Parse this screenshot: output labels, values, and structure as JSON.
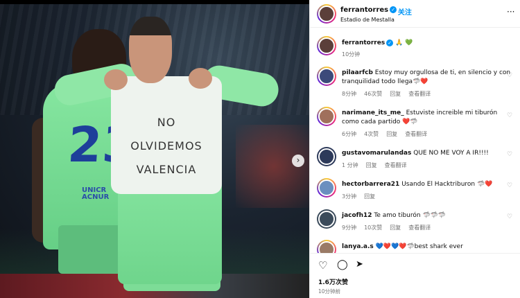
{
  "post": {
    "username": "ferrantorres",
    "follow_label": "关注",
    "location": "Estadio de Mestalla",
    "shirt_text_line1": "NO OLVIDEMOS",
    "shirt_text_line2": "VALENCIA",
    "jersey_number": "23",
    "sponsor_line1": "UNICR",
    "sponsor_line2": "ACNUR"
  },
  "caption": {
    "username": "ferrantorres",
    "emojis": "🙏 💚",
    "time": "10分钟"
  },
  "comments": [
    {
      "username": "pilaarfcb",
      "text": "Estoy muy orgullosa de ti, en silencio y con tranquilidad todo llega🦈❤️",
      "time": "8分钟",
      "likes": "46次赞",
      "reply": "回复",
      "translate": "查看翻译"
    },
    {
      "username": "narimane_its_me_",
      "text": "Estuviste increible mi tiburón como cada partido ❤️🦈",
      "time": "6分钟",
      "likes": "4次赞",
      "reply": "回复",
      "translate": "查看翻译"
    },
    {
      "username": "gustavomarulandas",
      "text": "QUE NO ME VOY A IR!!!!",
      "time": "1 分钟",
      "likes": "",
      "reply": "回复",
      "translate": "查看翻译"
    },
    {
      "username": "hectorbarrera21",
      "text": "Usando El Hacktriburon 🦈❤️",
      "time": "3分钟",
      "likes": "",
      "reply": "回复",
      "translate": ""
    },
    {
      "username": "jacofh12",
      "text": "Te amo tiburón 🦈🦈🦈",
      "time": "9分钟",
      "likes": "10次赞",
      "reply": "回复",
      "translate": "查看翻译"
    },
    {
      "username": "lanya.a.s",
      "text": "💙❤️💙❤️🦈best shark ever",
      "time": "",
      "likes": "",
      "reply": "",
      "translate": ""
    }
  ],
  "footer": {
    "likes": "1.6万次赞",
    "time": "10分钟前"
  },
  "colors": {
    "accent": "#0095f6",
    "jersey": "#86e6a0",
    "number": "#1e3f9a"
  }
}
